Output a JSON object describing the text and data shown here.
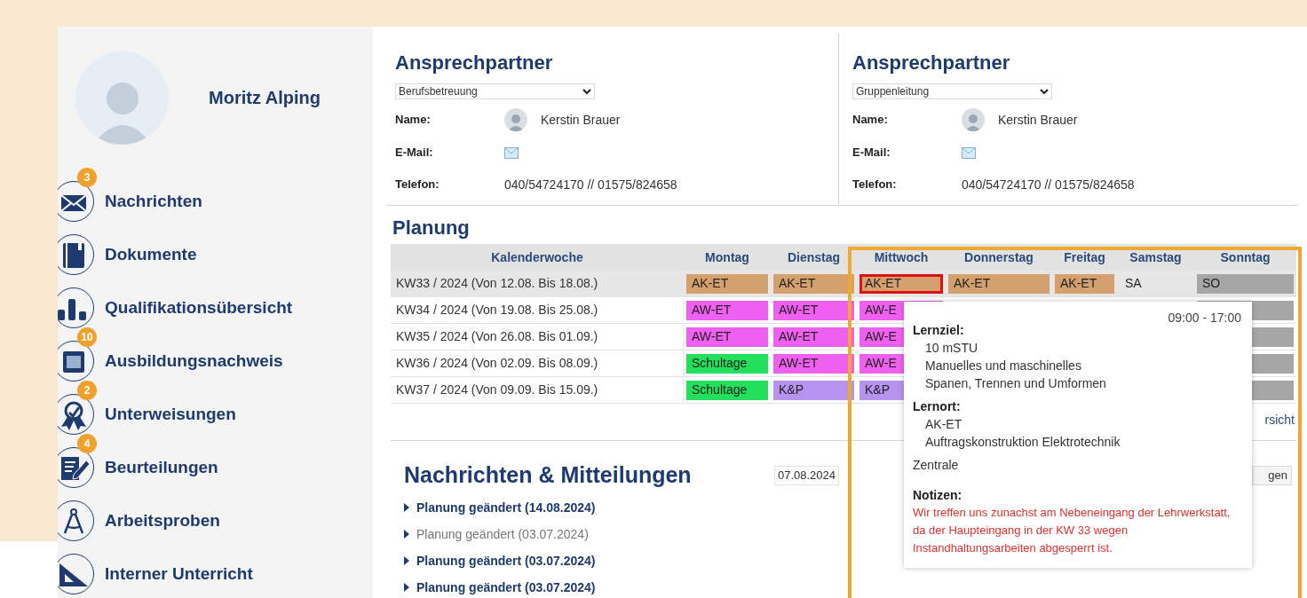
{
  "user": {
    "name": "Moritz Alping"
  },
  "nav": [
    {
      "label": "Nachrichten",
      "badge": "3"
    },
    {
      "label": "Dokumente"
    },
    {
      "label": "Qualifikationsübersicht"
    },
    {
      "label": "Ausbildungsnachweis",
      "badge": "10"
    },
    {
      "label": "Unterweisungen",
      "badge": "2"
    },
    {
      "label": "Beurteilungen",
      "badge": "4"
    },
    {
      "label": "Arbeitsproben"
    },
    {
      "label": "Interner Unterricht"
    }
  ],
  "contacts": [
    {
      "heading": "Ansprechpartner",
      "role": "Berufsbetreuung",
      "name_label": "Name:",
      "name": "Kerstin Brauer",
      "email_label": "E-Mail:",
      "phone_label": "Telefon:",
      "phone": "040/54724170 // 01575/824658"
    },
    {
      "heading": "Ansprechpartner",
      "role": "Gruppenleitung",
      "name_label": "Name:",
      "name": "Kerstin Brauer",
      "email_label": "E-Mail:",
      "phone_label": "Telefon:",
      "phone": "040/54724170 // 01575/824658"
    }
  ],
  "planning": {
    "heading": "Planung",
    "columns": [
      "Kalenderwoche",
      "Montag",
      "Dienstag",
      "Mittwoch",
      "Donnerstag",
      "Freitag",
      "Samstag",
      "Sonntag"
    ],
    "rows": [
      {
        "highlighted": true,
        "cells": [
          {
            "kind": "week",
            "text": "KW33 / 2024 (Von 12.08. Bis 18.08.)"
          },
          {
            "kind": "entry",
            "text": "AK-ET",
            "color": "#d4a06e",
            "selected": false
          },
          {
            "kind": "entry",
            "text": "AK-ET",
            "color": "#d4a06e",
            "selected": false
          },
          {
            "kind": "entry",
            "text": "AK-ET",
            "color": "#d4a06e",
            "selected": true
          },
          {
            "kind": "entry",
            "text": "AK-ET",
            "color": "#d4a06e",
            "selected": false
          },
          {
            "kind": "entry",
            "text": "AK-ET",
            "color": "#d4a06e",
            "selected": false
          },
          {
            "kind": "plain",
            "text": "SA",
            "selected": false
          },
          {
            "kind": "entry",
            "text": "SO",
            "color": "#a6a6a6",
            "selected": false
          }
        ]
      },
      {
        "highlighted": false,
        "cells": [
          {
            "kind": "week",
            "text": "KW34 / 2024 (Von 19.08. Bis 25.08.)"
          },
          {
            "kind": "entry",
            "text": "AW-ET",
            "color": "#f060f0",
            "selected": false
          },
          {
            "kind": "entry",
            "text": "AW-ET",
            "color": "#f060f0",
            "selected": false
          },
          {
            "kind": "entry",
            "text": "AW-E",
            "color": "#f060f0",
            "selected": false
          },
          {
            "kind": "blank"
          },
          {
            "kind": "blank"
          },
          {
            "kind": "blank"
          },
          {
            "kind": "entry",
            "color": "#a6a6a6",
            "selected": false
          }
        ]
      },
      {
        "highlighted": false,
        "cells": [
          {
            "kind": "week",
            "text": "KW35 / 2024 (Von 26.08. Bis 01.09.)"
          },
          {
            "kind": "entry",
            "text": "AW-ET",
            "color": "#f060f0",
            "selected": false
          },
          {
            "kind": "entry",
            "text": "AW-ET",
            "color": "#f060f0",
            "selected": false
          },
          {
            "kind": "entry",
            "text": "AW-E",
            "color": "#f060f0",
            "selected": false
          },
          {
            "kind": "blank"
          },
          {
            "kind": "blank"
          },
          {
            "kind": "blank"
          },
          {
            "kind": "entry",
            "color": "#a6a6a6",
            "selected": false
          }
        ]
      },
      {
        "highlighted": false,
        "cells": [
          {
            "kind": "week",
            "text": "KW36 / 2024 (Von 02.09. Bis 08.09.)"
          },
          {
            "kind": "entry",
            "text": "Schultage",
            "color": "#22e05c",
            "selected": false
          },
          {
            "kind": "entry",
            "text": "AW-ET",
            "color": "#f060f0",
            "selected": false
          },
          {
            "kind": "entry",
            "text": "AW-E",
            "color": "#f060f0",
            "selected": false
          },
          {
            "kind": "blank"
          },
          {
            "kind": "blank"
          },
          {
            "kind": "blank"
          },
          {
            "kind": "entry",
            "color": "#a6a6a6",
            "selected": false
          }
        ]
      },
      {
        "highlighted": false,
        "cells": [
          {
            "kind": "week",
            "text": "KW37 / 2024 (Von 09.09. Bis 15.09.)"
          },
          {
            "kind": "entry",
            "text": "Schultage",
            "color": "#22e05c",
            "selected": false
          },
          {
            "kind": "entry",
            "text": "K&P",
            "color": "#b793f0",
            "selected": false
          },
          {
            "kind": "entry",
            "text": "K&P",
            "color": "#b793f0",
            "selected": false
          },
          {
            "kind": "blank"
          },
          {
            "kind": "blank"
          },
          {
            "kind": "blank"
          },
          {
            "kind": "entry",
            "color": "#a6a6a6",
            "selected": false
          }
        ]
      }
    ],
    "link": "rsicht"
  },
  "tooltip": {
    "time": "09:00 - 17:00",
    "sections": [
      {
        "heading": "Lernziel:",
        "lines": [
          "10 mSTU",
          "Manuelles und maschinelles",
          "Spanen, Trennen und Umformen"
        ]
      },
      {
        "heading": "Lernort:",
        "lines": [
          "AK-ET",
          "Auftragskonstruktion Elektrotechnik"
        ]
      }
    ],
    "location": "Zentrale",
    "notes_heading": "Notizen:",
    "notes": "Wir treffen uns zunachst am Nebeneingang der Lehrwerkstatt, da der Haupteingang in der KW 33 wegen Instandhaltungsarbeiten abgesperrt ist."
  },
  "messages": {
    "heading": "Nachrichten & Mitteilungen",
    "date": "07.08.2024",
    "button": "gen",
    "items": [
      {
        "text": "Planung geändert (14.08.2024)",
        "unread": true
      },
      {
        "text": "Planung geändert (03.07.2024)",
        "unread": false
      },
      {
        "text": "Planung geändert (03.07.2024)",
        "unread": true
      },
      {
        "text": "Planung geändert (03.07.2024)",
        "unread": true
      }
    ]
  }
}
